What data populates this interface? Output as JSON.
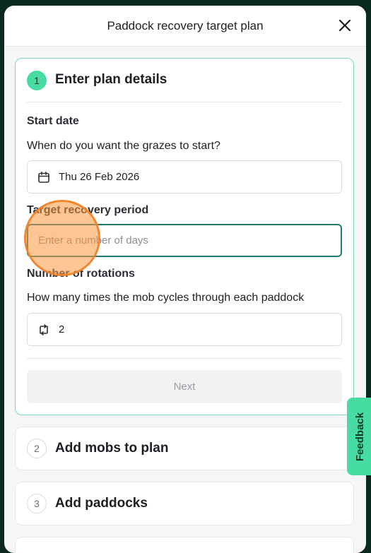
{
  "modal": {
    "title": "Paddock recovery target plan",
    "close_icon": "close-icon"
  },
  "steps": [
    {
      "number": "1",
      "title": "Enter plan details",
      "state": "active",
      "start_date": {
        "label": "Start date",
        "help": "When do you want the grazes to start?",
        "value": "Thu 26 Feb 2026",
        "icon": "calendar-icon"
      },
      "recovery": {
        "label": "Target recovery period",
        "placeholder": "Enter a number of days",
        "value": ""
      },
      "rotations": {
        "label": "Number of rotations",
        "help": "How many times the mob cycles through each paddock",
        "value": "2",
        "icon": "repeat-icon"
      },
      "next_label": "Next"
    },
    {
      "number": "2",
      "title": "Add mobs to plan",
      "state": "pending"
    },
    {
      "number": "3",
      "title": "Add paddocks",
      "state": "pending"
    }
  ],
  "feedback_label": "Feedback",
  "colors": {
    "accent": "#47dca1",
    "active_border": "#79d9b2",
    "focus_border": "#1f7a73",
    "background": "#0b2a1f"
  }
}
